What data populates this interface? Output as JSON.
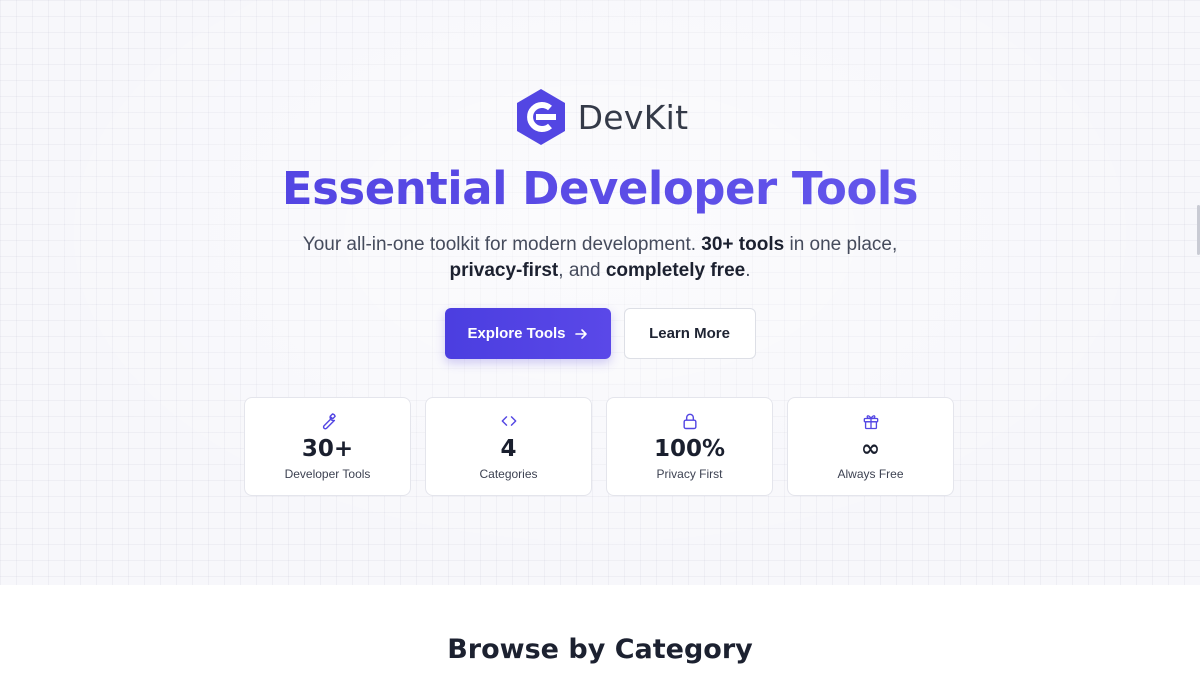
{
  "brand": {
    "name": "DevKit",
    "logo_icon": "devkit-logo-icon",
    "accent": "#5346e3"
  },
  "hero": {
    "headline": "Essential Developer Tools",
    "subtitle": {
      "part1": "Your all-in-one toolkit for modern development. ",
      "bold1": "30+ tools",
      "part2": " in one place, ",
      "bold2": "privacy-first",
      "part3": ", and ",
      "bold3": "completely free",
      "part4": "."
    },
    "primary_button": {
      "label": "Explore Tools",
      "icon": "arrow-right-icon"
    },
    "secondary_button": {
      "label": "Learn More"
    }
  },
  "stats": [
    {
      "icon": "wrench-icon",
      "value": "30+",
      "label": "Developer Tools"
    },
    {
      "icon": "code-icon",
      "value": "4",
      "label": "Categories"
    },
    {
      "icon": "lock-icon",
      "value": "100%",
      "label": "Privacy First"
    },
    {
      "icon": "gift-icon",
      "value": "∞",
      "label": "Always Free"
    }
  ],
  "section": {
    "title": "Browse by Category"
  }
}
